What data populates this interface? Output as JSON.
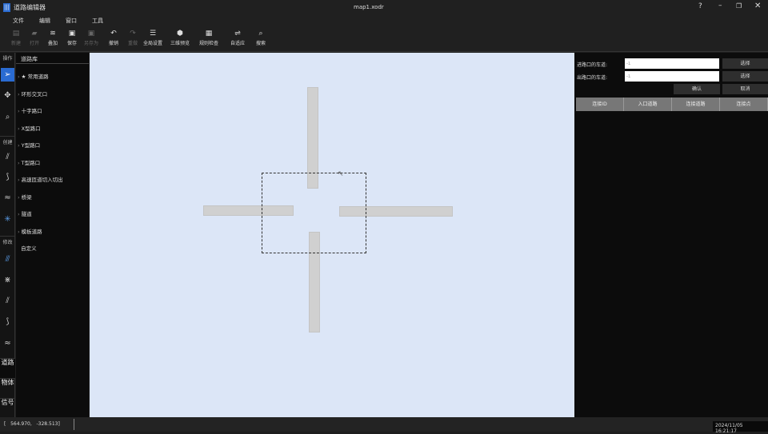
{
  "window": {
    "title": "道路编辑器",
    "file": "map1.xodr"
  },
  "menu": [
    "文件",
    "编辑",
    "窗口",
    "工具"
  ],
  "toolbar": [
    {
      "label": "新建",
      "icon": "▤",
      "enabled": false
    },
    {
      "label": "打开",
      "icon": "▰",
      "enabled": false
    },
    {
      "label": "叠加",
      "icon": "≋",
      "enabled": true
    },
    {
      "label": "保存",
      "icon": "▣",
      "enabled": true
    },
    {
      "label": "另存为",
      "icon": "▣",
      "enabled": false
    },
    {
      "label": "撤销",
      "icon": "↶",
      "enabled": true
    },
    {
      "label": "重做",
      "icon": "↷",
      "enabled": false
    },
    {
      "label": "全局设置",
      "icon": "☰",
      "enabled": true
    },
    {
      "label": "三维预览",
      "icon": "⬢",
      "enabled": true
    },
    {
      "label": "规则检查",
      "icon": "▦",
      "enabled": true
    },
    {
      "label": "自适应",
      "icon": "⇌",
      "enabled": true
    },
    {
      "label": "搜索",
      "icon": "⌕",
      "enabled": true
    }
  ],
  "left": {
    "sections": [
      "操作",
      "创建",
      "修改"
    ],
    "tabs": [
      "道路",
      "物体",
      "信号"
    ]
  },
  "library": {
    "title": "道路库",
    "items": [
      "常用道路",
      "环形交叉口",
      "十字路口",
      "X型路口",
      "Y型路口",
      "T型路口",
      "高速匝道切入切出",
      "桥梁",
      "隧道",
      "模板道路",
      "自定义"
    ]
  },
  "right": {
    "entry_label": "进路口的车道:",
    "exit_label": "出路口的车道:",
    "entry_value": "-1",
    "exit_value": "-1",
    "select": "选择",
    "confirm": "确认",
    "cancel": "取消",
    "columns": [
      "连接ID",
      "入口道路",
      "连接道路",
      "连接点"
    ]
  },
  "status": {
    "coords": "[   564.970,   -328.513]",
    "datetime": "2024/11/05 16:21:17"
  }
}
